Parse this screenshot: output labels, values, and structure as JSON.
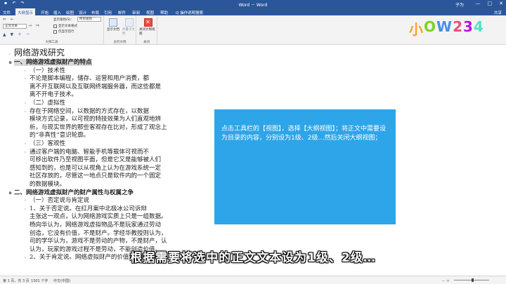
{
  "titlebar": {
    "title": "Word － Word",
    "account": "子为",
    "qat_icons": [
      "save-icon",
      "undo-icon",
      "redo-icon"
    ],
    "window_buttons": [
      "—",
      "□",
      "✕"
    ]
  },
  "tabs": {
    "items": [
      "文件",
      "大纲显示",
      "开始",
      "插入",
      "绘图",
      "设计",
      "布局",
      "引用",
      "邮件",
      "审阅",
      "视图",
      "帮助",
      "Q 操作说明搜索"
    ],
    "active": "大纲显示",
    "share": "共享"
  },
  "ribbon": {
    "level_select": "正文文本",
    "show_level_label": "显示级别(S):",
    "show_level_value": "所有级别",
    "checks": [
      "显示文本格式",
      "仅显示首行"
    ],
    "group_outline_tools": "大纲工具",
    "btn_show_document": "显示文档",
    "btn_collapse_subdocs": "折叠子文档",
    "group_master_document": "主控文档",
    "btn_close_outline": "关闭大纲视图",
    "group_close": "关闭"
  },
  "logo": {
    "text": "小OW234",
    "colors": [
      "#f5a623",
      "#7ed321",
      "#4a90e2",
      "#e94e77",
      "#bd10e0",
      "#50e3c2"
    ]
  },
  "document": {
    "lines": [
      {
        "text": "网络游戏研究",
        "style": "h0",
        "bullet": "◦"
      },
      {
        "text": "一、网络游戏虚拟财产的特点",
        "style": "h1",
        "bullet": "⊕",
        "highlight": true
      },
      {
        "text": "（一）技术性",
        "style": "body",
        "bullet": "◦",
        "indent": 1
      },
      {
        "text": "不论是脚本编程，储存、运营和用户消费，都",
        "style": "body",
        "bullet": "◦",
        "indent": 1
      },
      {
        "text": "离不开互联网以及互联网终端服务器，而这些都是",
        "style": "body",
        "bullet": "",
        "indent": 1
      },
      {
        "text": "离不开电子技术。",
        "style": "body",
        "bullet": "",
        "indent": 1
      },
      {
        "text": "（二）虚拟性",
        "style": "body",
        "bullet": "◦",
        "indent": 1
      },
      {
        "text": "存在于网络空间，以数据的方式存在，以数据",
        "style": "body",
        "bullet": "◦",
        "indent": 1
      },
      {
        "text": "模块方式记录，以可视的特技效果为人们直观地辨",
        "style": "body",
        "bullet": "",
        "indent": 1
      },
      {
        "text": "析，与现实世界的那些客观存在比对，形成了观念上",
        "style": "body",
        "bullet": "",
        "indent": 1
      },
      {
        "text": "的“非真性”意识轮廓。",
        "style": "body",
        "bullet": "",
        "indent": 1
      },
      {
        "text": "（三）客观性",
        "style": "body",
        "bullet": "◦",
        "indent": 1
      },
      {
        "text": "通过客户端的电脑、智能手机等载体可视而不",
        "style": "body",
        "bullet": "◦",
        "indent": 1
      },
      {
        "text": "可移出软件乃至视图平面，但是它又是能够被人们",
        "style": "body",
        "bullet": "",
        "indent": 1
      },
      {
        "text": "感知到的，也是可以从视角上认为在游戏系统一定",
        "style": "body",
        "bullet": "",
        "indent": 1
      },
      {
        "text": "社区存放的，尽管这一地点只是软件内的一个固定",
        "style": "body",
        "bullet": "",
        "indent": 1
      },
      {
        "text": "的数据模块。",
        "style": "body",
        "bullet": "",
        "indent": 1
      },
      {
        "text": "二、网络游戏虚拟财产的财产属性与权属之争",
        "style": "h1",
        "bullet": "⊕"
      },
      {
        "text": "（一）否定说与肯定说",
        "style": "body",
        "bullet": "◦",
        "indent": 1
      },
      {
        "text": "1、关于否定说。在红月案中北极冰公司诉辩",
        "style": "body",
        "bullet": "◦",
        "indent": 1
      },
      {
        "text": "主张这一观点，认为网络游戏实质上只是一组数据。",
        "style": "body",
        "bullet": "",
        "indent": 1
      },
      {
        "text": "杨向华认为，网络游戏虚拟物品不是玩家通过劳动",
        "style": "body",
        "bullet": "",
        "indent": 1
      },
      {
        "text": "创造，它没有价值，不是财产。学经华教授则认为，",
        "style": "body",
        "bullet": "",
        "indent": 1
      },
      {
        "text": "司的学华认为，游戏不是劳动的产物，不是财产，认",
        "style": "body",
        "bullet": "",
        "indent": 1
      },
      {
        "text": "认为，玩家的游戏过程不是劳动，不能创造价值。",
        "style": "body",
        "bullet": "",
        "indent": 1
      },
      {
        "text": "2、关于肯定说。网络虚拟财产的价值性已经",
        "style": "body",
        "bullet": "◦",
        "indent": 1
      }
    ]
  },
  "tip": {
    "text": "点击工具栏的【视图】，选择【大纲视图】；将正文中需要设为目录的内容，分别设为1级、2级…然后关闭大纲视图；"
  },
  "caption": "根据需要将选中的正文文本设为1级、2级…",
  "status": {
    "page": "第 1 页，共 3 页",
    "words": "1301 个字",
    "lang": "中文(中国)",
    "zoom_ctrls": "－ ＋"
  }
}
